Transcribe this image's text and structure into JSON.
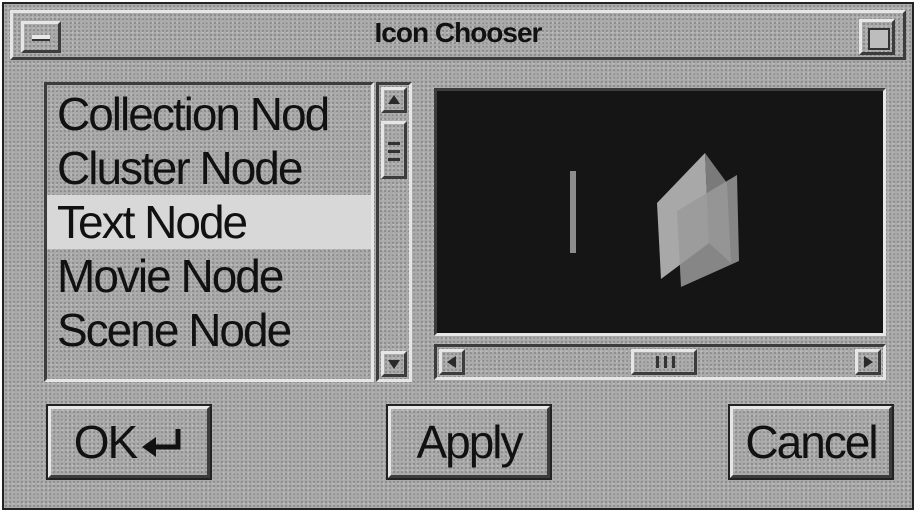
{
  "window": {
    "title": "Icon Chooser"
  },
  "list": {
    "items": [
      {
        "label": "Collection Nod"
      },
      {
        "label": "Cluster Node"
      },
      {
        "label": "Text Node",
        "selected": true
      },
      {
        "label": "Movie Node"
      },
      {
        "label": "Scene Node"
      }
    ]
  },
  "buttons": {
    "ok_label": "OK",
    "ok_icon": "enter-arrow-icon",
    "apply_label": "Apply",
    "cancel_label": "Cancel"
  },
  "colors": {
    "window_bg": "#a9a9a9",
    "preview_bg": "#151515",
    "selected_item_bg": "#d8d8d8"
  }
}
